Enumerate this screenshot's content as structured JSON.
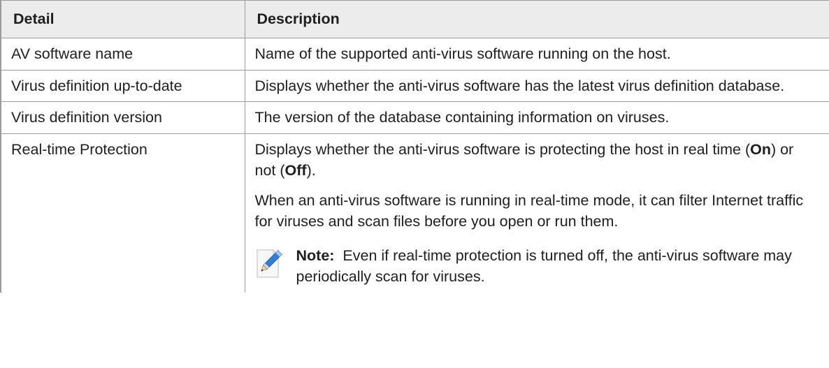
{
  "table": {
    "headers": [
      "Detail",
      "Description"
    ],
    "rows": [
      {
        "detail": "AV software name",
        "description": "Name of the supported anti-virus software running on the host."
      },
      {
        "detail": "Virus definition up-to-date",
        "description": "Displays whether the anti-virus software has the latest virus definition database."
      },
      {
        "detail": "Virus definition version",
        "description": "The version of the database containing information on viruses."
      },
      {
        "detail": "Real-time Protection",
        "description_parts": {
          "a": "Displays whether the anti-virus software is protecting the host in real time (",
          "on": "On",
          "b": ") or not (",
          "off": "Off",
          "c": ")."
        },
        "paragraph2": "When an anti-virus software is running in real-time mode, it can filter Internet traffic for viruses and scan files before you open or run them.",
        "note_label": "Note:",
        "note_text": "Even if real-time protection is turned off, the anti-virus software may periodically scan for viruses."
      }
    ]
  },
  "icons": {
    "note": "pencil-note-icon"
  }
}
